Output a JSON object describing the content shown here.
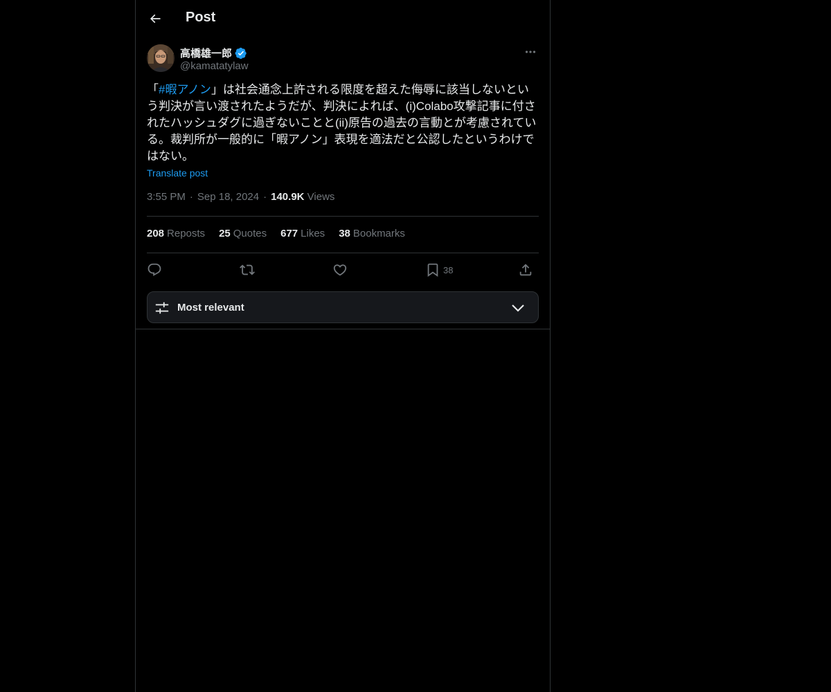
{
  "header": {
    "title": "Post"
  },
  "author": {
    "display_name": "高橋雄一郎",
    "handle": "@kamatatylaw",
    "verified": true
  },
  "post": {
    "text_before": "「",
    "hashtag": "#暇アノン",
    "text_after": "」は社会通念上許される限度を超えた侮辱に該当しないという判決が言い渡されたようだが、判決によれば、(i)Colabo攻撃記事に付されたハッシュダグに過ぎないことと(ii)原告の過去の言動とが考慮されている。裁判所が一般的に「暇アノン」表現を適法だと公認したというわけではない。",
    "translate_label": "Translate post"
  },
  "meta": {
    "time": "3:55 PM",
    "separator": "·",
    "date": "Sep 18, 2024",
    "views_count": "140.9K",
    "views_label": "Views"
  },
  "stats": [
    {
      "count": "208",
      "label": "Reposts"
    },
    {
      "count": "25",
      "label": "Quotes"
    },
    {
      "count": "677",
      "label": "Likes"
    },
    {
      "count": "38",
      "label": "Bookmarks"
    }
  ],
  "actions": {
    "bookmark_count": "38"
  },
  "sort": {
    "label": "Most relevant"
  },
  "colors": {
    "background": "#000000",
    "text": "#e7e9ea",
    "secondary": "#71767b",
    "accent": "#1d9bf0",
    "border": "#2f3336"
  },
  "icons": [
    "back-arrow-icon",
    "verified-badge-icon",
    "more-icon",
    "reply-icon",
    "repost-icon",
    "like-icon",
    "bookmark-icon",
    "share-icon",
    "sliders-icon",
    "chevron-down-icon"
  ]
}
